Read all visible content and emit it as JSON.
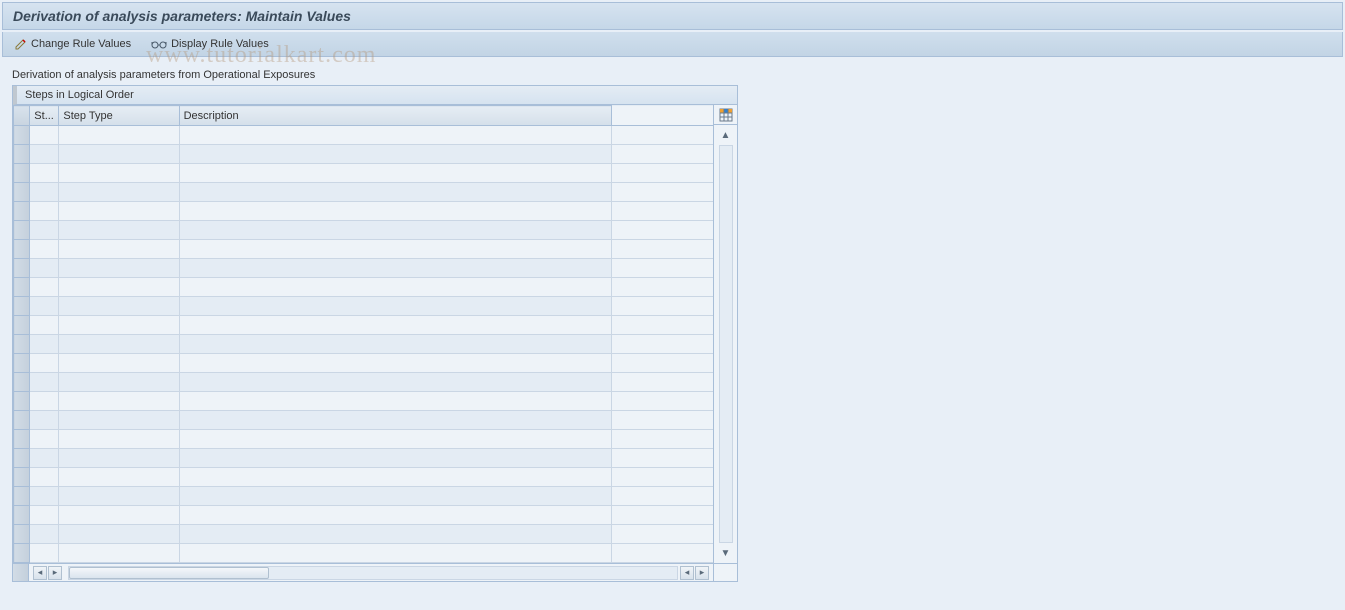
{
  "title": "Derivation of analysis parameters: Maintain Values",
  "toolbar": {
    "change_rule_label": "Change Rule Values",
    "display_rule_label": "Display Rule Values"
  },
  "subtitle": "Derivation of analysis parameters from Operational Exposures",
  "panel": {
    "header": "Steps in Logical Order",
    "columns": {
      "st": "St...",
      "step_type": "Step Type",
      "description": "Description"
    }
  },
  "watermark": "www.tutorialkart.com",
  "grid_rows": 23
}
